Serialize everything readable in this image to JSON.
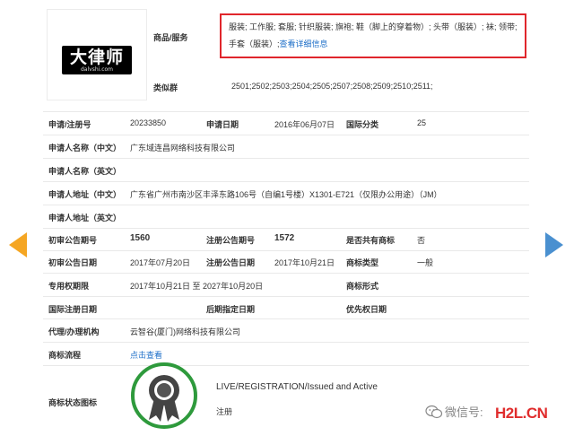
{
  "logo": {
    "main": "大律师",
    "sub": "dalvshi.com"
  },
  "goods": {
    "label": "商品/服务",
    "text": "服装; 工作服; 套服; 针织服装; 旗袍; 鞋（脚上的穿着物）; 头带（服装）; 袜; 领带; 手套（服装）;",
    "link": "查看详细信息"
  },
  "similar_group": {
    "label": "类似群",
    "value": "2501;2502;2503;2504;2505;2507;2508;2509;2510;2511;"
  },
  "rows": {
    "reg_no": {
      "label": "申请/注册号",
      "value": "20233850"
    },
    "app_date": {
      "label": "申请日期",
      "value": "2016年06月07日"
    },
    "intl_class": {
      "label": "国际分类",
      "value": "25"
    },
    "applicant_cn": {
      "label": "申请人名称（中文）",
      "value": "广东域连昌网络科技有限公司"
    },
    "applicant_en": {
      "label": "申请人名称（英文）",
      "value": ""
    },
    "address_cn": {
      "label": "申请人地址（中文）",
      "value": "广东省广州市南沙区丰泽东路106号（自编1号楼）X1301-E721（仅限办公用途）（JM）"
    },
    "address_en": {
      "label": "申请人地址（英文）",
      "value": ""
    },
    "prelim_no": {
      "label": "初审公告期号",
      "value": "1560"
    },
    "reg_pub_no": {
      "label": "注册公告期号",
      "value": "1572"
    },
    "shared": {
      "label": "是否共有商标",
      "value": "否"
    },
    "prelim_date": {
      "label": "初审公告日期",
      "value": "2017年07月20日"
    },
    "reg_pub_date": {
      "label": "注册公告日期",
      "value": "2017年10月21日"
    },
    "tm_type": {
      "label": "商标类型",
      "value": "一般"
    },
    "exclusive": {
      "label": "专用权期限",
      "value": "2017年10月21日 至 2027年10月20日"
    },
    "tm_form": {
      "label": "商标形式",
      "value": ""
    },
    "intl_reg_date": {
      "label": "国际注册日期",
      "value": ""
    },
    "later_date": {
      "label": "后期指定日期",
      "value": ""
    },
    "priority_date": {
      "label": "优先权日期",
      "value": ""
    },
    "agent": {
      "label": "代理/办理机构",
      "value": "云智谷(厦门)网络科技有限公司"
    },
    "process": {
      "label": "商标流程",
      "value": "点击查看"
    },
    "status_icon": {
      "label": "商标状态图标",
      "status": "LIVE/REGISTRATION/Issued and Active",
      "sub": "注册"
    }
  },
  "watermark": {
    "text": "微信号:",
    "brand": "H2L.CN"
  },
  "colors": {
    "accent_red": "#e0262c",
    "link_blue": "#1e6fc8",
    "arrow_orange": "#f5a623",
    "arrow_blue": "#4a90d0",
    "status_green": "#2e9a3c"
  },
  "icons": [
    "prev-arrow-icon",
    "next-arrow-icon",
    "award-badge-icon",
    "wechat-icon"
  ]
}
